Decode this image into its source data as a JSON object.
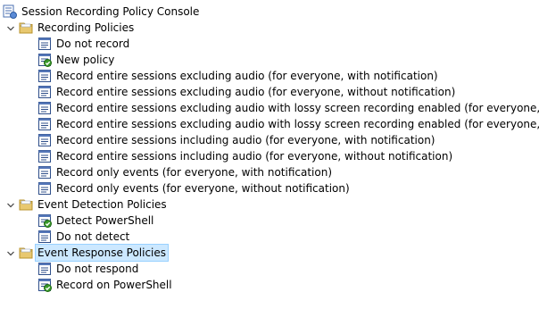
{
  "tree": {
    "root": {
      "label": "Session Recording Policy Console",
      "icon": "console-icon"
    },
    "groups": [
      {
        "label": "Recording Policies",
        "expanded": true,
        "selected": false,
        "items": [
          {
            "label": "Do not record",
            "icon": "policy-icon",
            "active": false
          },
          {
            "label": "New policy",
            "icon": "active-policy-icon",
            "active": true
          },
          {
            "label": "Record entire sessions excluding audio (for everyone, with notification)",
            "icon": "policy-icon",
            "active": false
          },
          {
            "label": "Record entire sessions excluding audio (for everyone, without notification)",
            "icon": "policy-icon",
            "active": false
          },
          {
            "label": "Record entire sessions excluding audio with lossy screen recording enabled (for everyone, with notifica",
            "icon": "policy-icon",
            "active": false
          },
          {
            "label": "Record entire sessions excluding audio with lossy screen recording enabled (for everyone, without noti",
            "icon": "policy-icon",
            "active": false
          },
          {
            "label": "Record entire sessions including audio (for everyone, with notification)",
            "icon": "policy-icon",
            "active": false
          },
          {
            "label": "Record entire sessions including audio (for everyone, without notification)",
            "icon": "policy-icon",
            "active": false
          },
          {
            "label": "Record only events (for everyone, with notification)",
            "icon": "policy-icon",
            "active": false
          },
          {
            "label": "Record only events (for everyone, without notification)",
            "icon": "policy-icon",
            "active": false
          }
        ]
      },
      {
        "label": "Event Detection Policies",
        "expanded": true,
        "selected": false,
        "items": [
          {
            "label": "Detect PowerShell",
            "icon": "active-policy-icon",
            "active": true
          },
          {
            "label": "Do not detect",
            "icon": "policy-icon",
            "active": false
          }
        ]
      },
      {
        "label": "Event Response Policies",
        "expanded": true,
        "selected": true,
        "items": [
          {
            "label": "Do not respond",
            "icon": "policy-icon",
            "active": false
          },
          {
            "label": "Record on PowerShell",
            "icon": "active-policy-icon",
            "active": true
          }
        ]
      }
    ]
  },
  "colors": {
    "selection_bg": "#cce8ff",
    "selection_border": "#99d1ff",
    "folder": "#e8c870",
    "check": "#3a9a2a"
  }
}
